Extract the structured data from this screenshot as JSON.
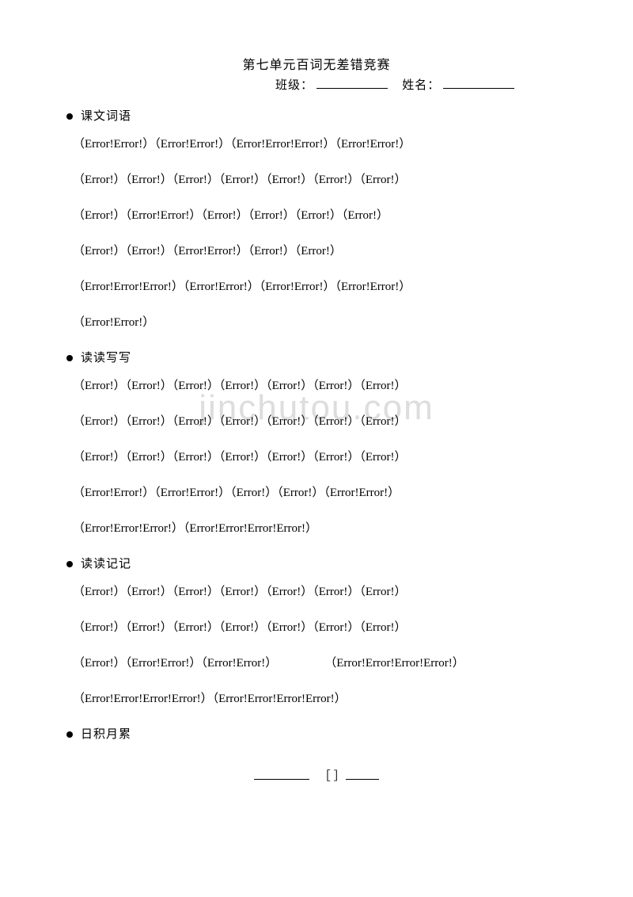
{
  "title": "第七单元百词无差错竞赛",
  "class_label": "班级：",
  "name_label": "姓名：",
  "watermark": "jinchutou.com",
  "sections": {
    "s1": {
      "head": "课文词语"
    },
    "s2": {
      "head": "读读写写"
    },
    "s3": {
      "head": "读读记记"
    },
    "s4": {
      "head": "日积月累"
    }
  },
  "lines": {
    "s1l1": "（Error!Error!）（Error!Error!）（Error!Error!Error!）（Error!Error!）",
    "s1l2": "（Error!）（Error!）（Error!）（Error!）（Error!）（Error!）（Error!）",
    "s1l3": "（Error!）（Error!Error!）（Error!）（Error!）（Error!）（Error!）",
    "s1l4": "（Error!）（Error!）（Error!Error!）（Error!）（Error!）",
    "s1l5": "（Error!Error!Error!）（Error!Error!）（Error!Error!）（Error!Error!）",
    "s1l6": "（Error!Error!）",
    "s2l1": "（Error!）（Error!）（Error!）（Error!）（Error!）（Error!）（Error!）",
    "s2l2": "（Error!）（Error!）（Error!）（Error!）（Error!）（Error!）（Error!）",
    "s2l3": "（Error!）（Error!）（Error!）（Error!）（Error!）（Error!）（Error!）",
    "s2l4": "（Error!Error!）（Error!Error!）（Error!）（Error!）（Error!Error!）",
    "s2l5": "（Error!Error!Error!）（Error!Error!Error!Error!）",
    "s3l1": "（Error!）（Error!）（Error!）（Error!）（Error!）（Error!）（Error!）",
    "s3l2": "（Error!）（Error!）（Error!）（Error!）（Error!）（Error!）（Error!）",
    "s3l3a": "（Error!）（Error!Error!）（Error!Error!）",
    "s3l3b": "（Error!Error!Error!Error!）",
    "s3l4": "（Error!Error!Error!Error!）（Error!Error!Error!Error!）"
  },
  "bottom_bracket": "［  ］"
}
